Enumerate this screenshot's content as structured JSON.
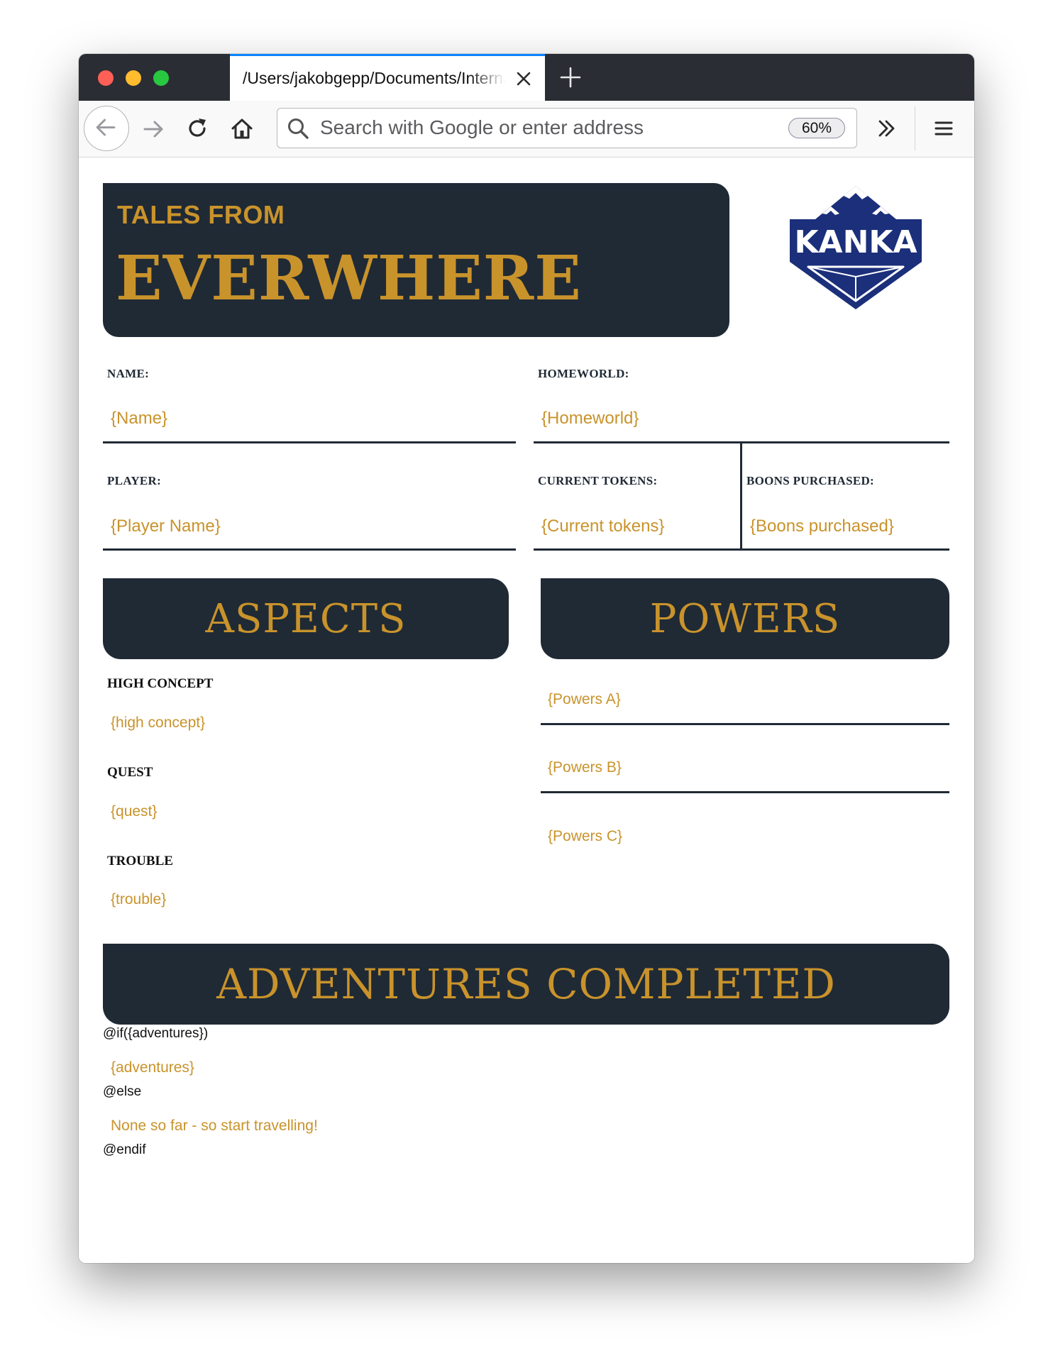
{
  "browser": {
    "tab_title": "/Users/jakobgepp/Documents/Internal",
    "url_placeholder": "Search with Google or enter address",
    "zoom": "60%",
    "icons": [
      "back-arrow-icon",
      "forward-arrow-icon",
      "reload-icon",
      "home-icon",
      "search-icon",
      "overflow-chevrons-icon",
      "hamburger-menu-icon",
      "close-icon",
      "plus-icon"
    ]
  },
  "header": {
    "subtitle": "TALES FROM",
    "title": "EVERWHERE",
    "logo_text": "KANKA"
  },
  "fields": {
    "name_label": "NAME:",
    "name_value": "{Name}",
    "homeworld_label": "HOMEWORLD:",
    "homeworld_value": "{Homeworld}",
    "player_label": "PLAYER:",
    "player_value": "{Player Name}",
    "tokens_label": "CURRENT TOKENS:",
    "tokens_value": "{Current tokens}",
    "boons_label": "BOONS PURCHASED:",
    "boons_value": "{Boons purchased}"
  },
  "aspects": {
    "title": "ASPECTS",
    "items": [
      {
        "label": "HIGH CONCEPT",
        "value": "{high concept}"
      },
      {
        "label": "QUEST",
        "value": "{quest}"
      },
      {
        "label": "TROUBLE",
        "value": "{trouble}"
      }
    ]
  },
  "powers": {
    "title": "POWERS",
    "items": [
      "{Powers A}",
      "{Powers B}",
      "{Powers C}"
    ]
  },
  "adventures": {
    "title": "ADVENTURES COMPLETED",
    "if_line": "@if({adventures})",
    "value": "{adventures}",
    "else_line": "@else",
    "empty_text": "None so far - so start travelling!",
    "endif_line": "@endif"
  },
  "colors": {
    "navy": "#202a35",
    "gold": "#c9932b",
    "logo_blue": "#1b2f7a",
    "tab_accent": "#0a84ff"
  }
}
